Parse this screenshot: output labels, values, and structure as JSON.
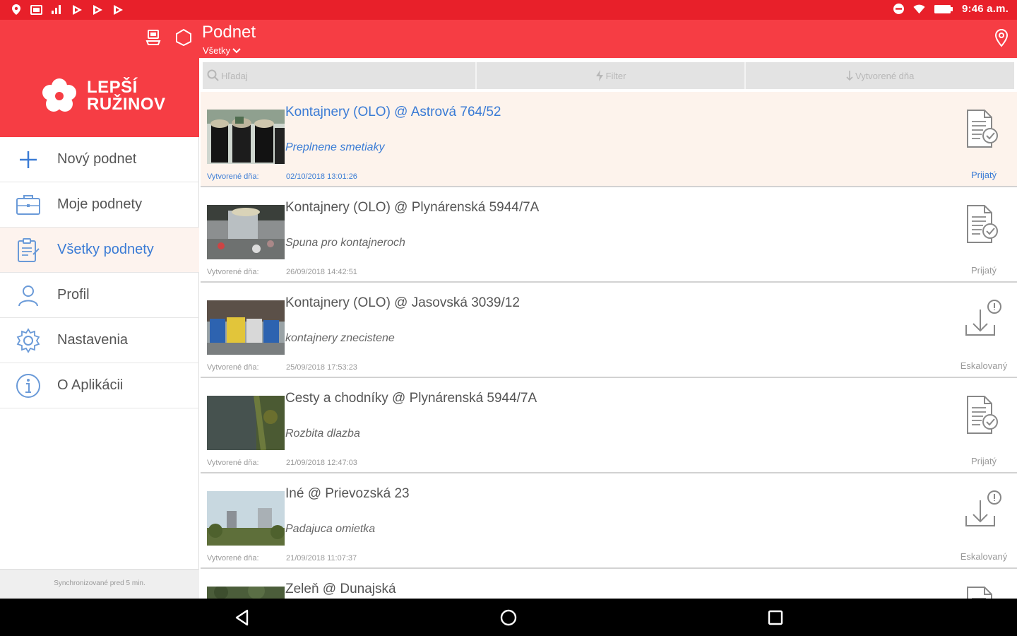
{
  "status_bar": {
    "time": "9:46 a.m.",
    "left_icons": [
      "location-icon",
      "image-icon",
      "signal-icon",
      "play-store-icon",
      "play-store-icon",
      "play-store-icon"
    ],
    "right_icons": [
      "dnd-icon",
      "wifi-icon",
      "battery-icon"
    ]
  },
  "app_bar": {
    "title": "Podnet",
    "subtitle": "Všetky",
    "icons": [
      "sync-device-icon",
      "hexagon-icon",
      "map-pin-icon"
    ]
  },
  "sidebar": {
    "brand": {
      "line1": "LEPŠÍ",
      "line2": "RUŽINOV"
    },
    "items": [
      {
        "label": "Nový podnet",
        "icon": "plus-icon",
        "active": false
      },
      {
        "label": "Moje podnety",
        "icon": "briefcase-icon",
        "active": false
      },
      {
        "label": "Všetky podnety",
        "icon": "clipboard-icon",
        "active": true
      },
      {
        "label": "Profil",
        "icon": "user-icon",
        "active": false
      },
      {
        "label": "Nastavenia",
        "icon": "gear-icon",
        "active": false
      },
      {
        "label": "O Aplikácii",
        "icon": "info-icon",
        "active": false
      }
    ],
    "sync_text": "Synchronizované pred 5 min."
  },
  "toolbar": {
    "search_placeholder": "Hľadaj",
    "filter_label": "Filter",
    "sort_label": "Vytvorené dňa"
  },
  "list": {
    "date_label": "Vytvorené dňa:",
    "items": [
      {
        "title": "Kontajnery (OLO) @ Astrová 764/52",
        "desc": "Preplnene smetiaky",
        "date": "02/10/2018 13:01:26",
        "status": "Prijatý",
        "status_icon": "document-check-icon",
        "highlight": true
      },
      {
        "title": "Kontajnery (OLO) @ Plynárenská 5944/7A",
        "desc": "Spuna pro kontajneroch",
        "date": "26/09/2018 14:42:51",
        "status": "Prijatý",
        "status_icon": "document-check-icon",
        "highlight": false
      },
      {
        "title": "Kontajnery (OLO) @ Jasovská 3039/12",
        "desc": "kontajnery znecistene",
        "date": "25/09/2018 17:53:23",
        "status": "Eskalovaný",
        "status_icon": "escalate-icon",
        "highlight": false
      },
      {
        "title": "Cesty a chodníky @ Plynárenská 5944/7A",
        "desc": "Rozbita dlazba",
        "date": "21/09/2018 12:47:03",
        "status": "Prijatý",
        "status_icon": "document-check-icon",
        "highlight": false
      },
      {
        "title": "Iné @ Prievozská 23",
        "desc": "Padajuca omietka",
        "date": "21/09/2018 11:07:37",
        "status": "Eskalovaný",
        "status_icon": "escalate-icon",
        "highlight": false
      },
      {
        "title": "Zeleň @ Dunajská",
        "desc": "",
        "date": "",
        "status": "",
        "status_icon": "document-check-icon",
        "highlight": false
      }
    ]
  },
  "nav_bar": {
    "buttons": [
      "back-icon",
      "home-icon",
      "recents-icon"
    ]
  },
  "colors": {
    "status_bar": "#e8202a",
    "app_bar": "#f63d44",
    "accent_blue": "#3a7bd5",
    "highlight_row": "#fdf3ec"
  }
}
